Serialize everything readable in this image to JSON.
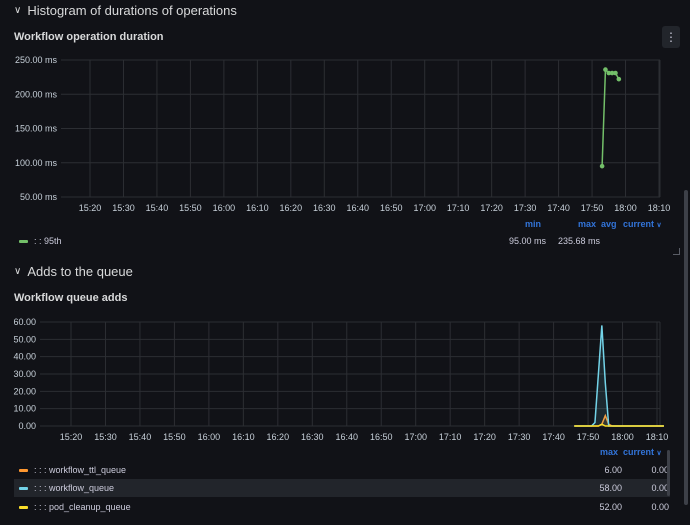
{
  "sections": [
    {
      "title": "Histogram of durations of operations"
    },
    {
      "title": "Adds to the queue"
    }
  ],
  "panel1": {
    "title": "Workflow operation duration",
    "menu_icon": "⋮",
    "legend_headers": {
      "min": "min",
      "max": "max",
      "avg": "avg",
      "current": "current"
    },
    "legend": [
      {
        "name": ": : 95th",
        "color": "#73bf69",
        "min": "95.00 ms",
        "max": "235.68 ms",
        "avg": "",
        "current": ""
      }
    ]
  },
  "panel2": {
    "title": "Workflow queue adds",
    "legend_headers": {
      "max": "max",
      "current": "current"
    },
    "legend": [
      {
        "name": ": : : workflow_ttl_queue",
        "color": "#ff9830",
        "max": "6.00",
        "current": "0.00"
      },
      {
        "name": ": : : workflow_queue",
        "color": "#73d3e8",
        "max": "58.00",
        "current": "0.00"
      },
      {
        "name": ": : : pod_cleanup_queue",
        "color": "#fade2a",
        "max": "52.00",
        "current": "0.00"
      }
    ]
  },
  "chart_data": [
    {
      "type": "line",
      "title": "Workflow operation duration",
      "y_ticks": [
        "250.00 ms",
        "200.00 ms",
        "150.00 ms",
        "100.00 ms",
        "50.00 ms"
      ],
      "x_ticks": [
        "15:20",
        "15:30",
        "15:40",
        "15:50",
        "16:00",
        "16:10",
        "16:20",
        "16:30",
        "16:40",
        "16:50",
        "17:00",
        "17:10",
        "17:20",
        "17:30",
        "17:40",
        "17:50",
        "18:00",
        "18:10"
      ],
      "ylim": [
        50,
        250
      ],
      "grid": true,
      "series": [
        {
          "name": ": : 95th",
          "color": "#73bf69",
          "x": [
            "17:53",
            "17:54",
            "17:55",
            "17:56",
            "17:57",
            "17:58"
          ],
          "y": [
            95,
            236,
            231,
            231,
            231,
            222
          ]
        }
      ]
    },
    {
      "type": "line",
      "title": "Workflow queue adds",
      "y_ticks": [
        "60.00",
        "50.00",
        "40.00",
        "30.00",
        "20.00",
        "10.00",
        "0.00"
      ],
      "x_ticks": [
        "15:20",
        "15:30",
        "15:40",
        "15:50",
        "16:00",
        "16:10",
        "16:20",
        "16:30",
        "16:40",
        "16:50",
        "17:00",
        "17:10",
        "17:20",
        "17:30",
        "17:40",
        "17:50",
        "18:00",
        "18:10"
      ],
      "ylim": [
        0,
        60
      ],
      "grid": true,
      "series": [
        {
          "name": ": : : workflow_ttl_queue",
          "color": "#ff9830",
          "x": [
            "17:46",
            "17:53",
            "17:54",
            "17:55",
            "17:56",
            "17:57",
            "18:12"
          ],
          "y": [
            0,
            0,
            1,
            6,
            1,
            0,
            0
          ]
        },
        {
          "name": ": : : workflow_queue",
          "color": "#73d3e8",
          "x": [
            "17:46",
            "17:51",
            "17:52",
            "17:53",
            "17:54",
            "17:55",
            "17:56",
            "18:12"
          ],
          "y": [
            0,
            0,
            2,
            30,
            58,
            25,
            0,
            0
          ]
        },
        {
          "name": ": : : pod_cleanup_queue",
          "color": "#fade2a",
          "x": [
            "17:46",
            "17:52",
            "17:53",
            "17:54",
            "17:55",
            "17:56",
            "18:12"
          ],
          "y": [
            0,
            0,
            0,
            1,
            0,
            0,
            0
          ]
        }
      ]
    }
  ]
}
